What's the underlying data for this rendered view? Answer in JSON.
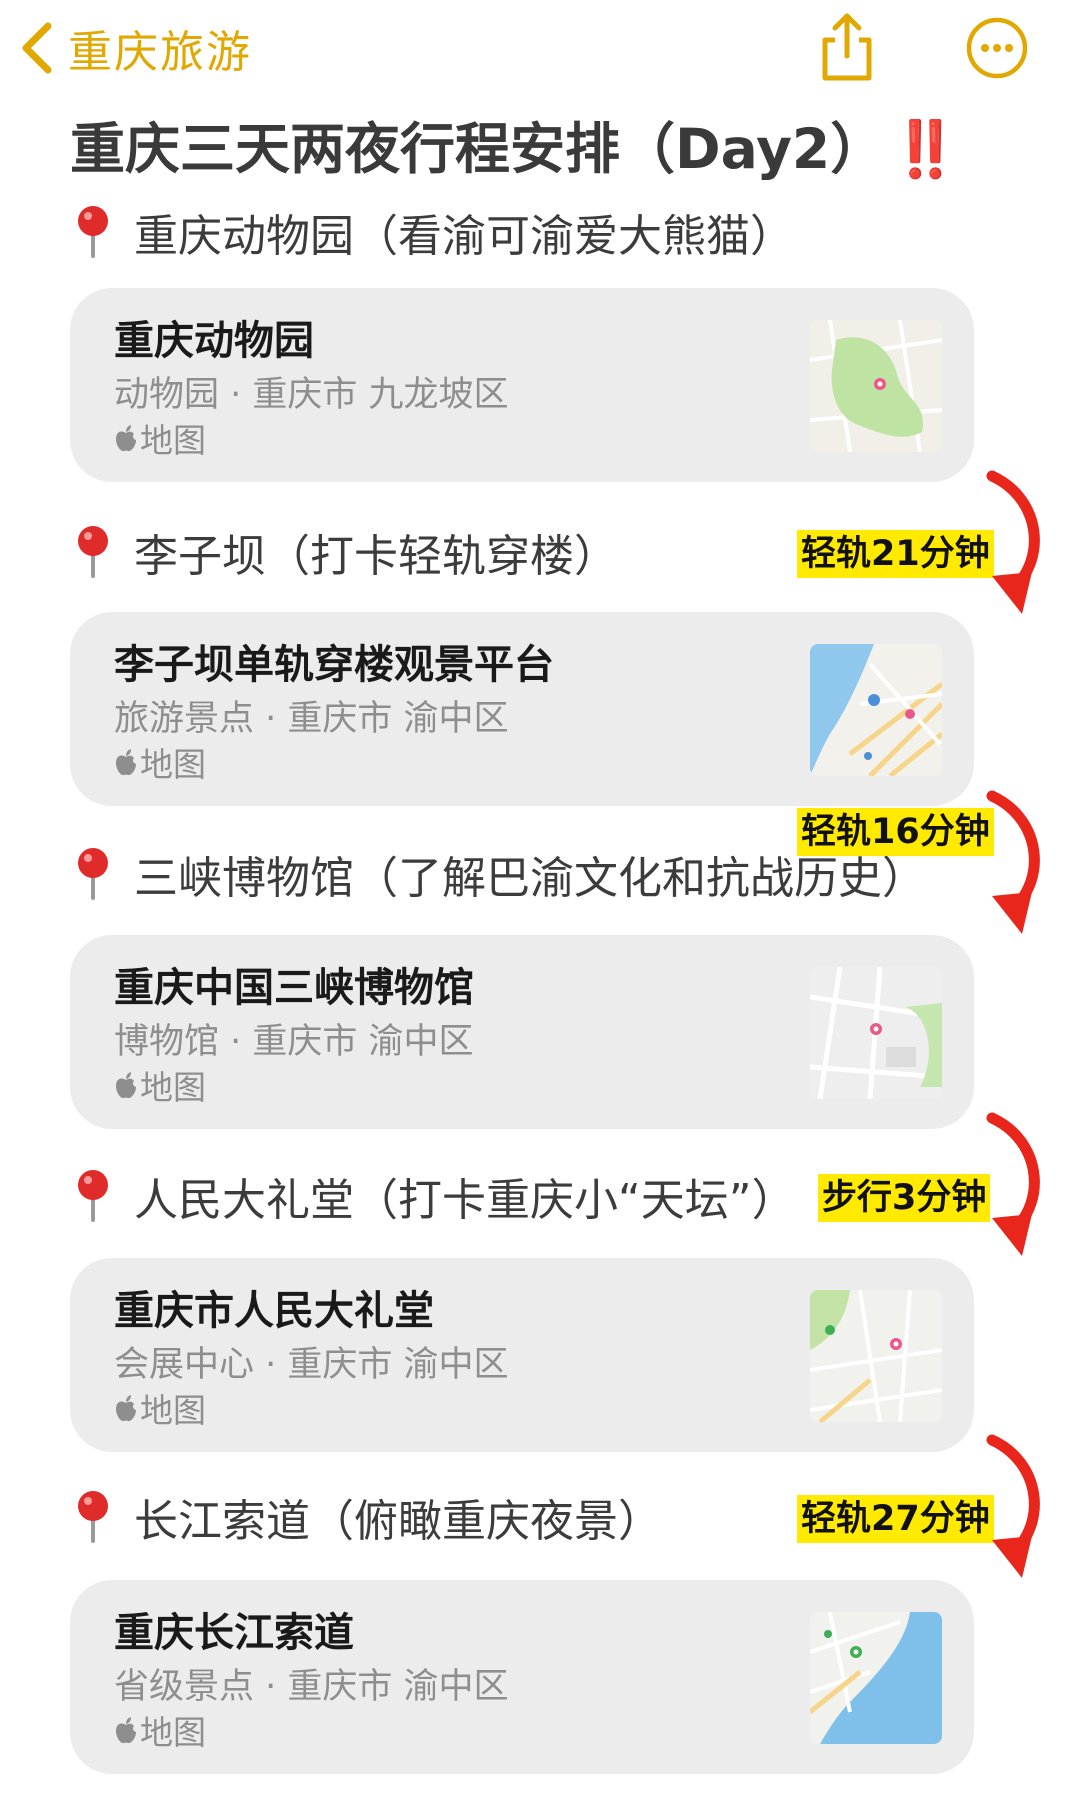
{
  "nav": {
    "back_label": "重庆旅游",
    "accent_color": "#E0A800",
    "share_icon": "share-icon",
    "more_icon": "more-icon"
  },
  "title": {
    "text": "重庆三天两夜行程安排（Day2）",
    "emphasis": "‼️"
  },
  "stops": [
    {
      "heading": "重庆动物园（看渝可渝爱大熊猫）",
      "card": {
        "name": "重庆动物园",
        "category": "动物园 · 重庆市 九龙坡区",
        "maps_label": "地图",
        "map": "green-park"
      }
    },
    {
      "heading": "李子坝（打卡轻轨穿楼）",
      "transit": "轻轨21分钟",
      "card": {
        "name": "李子坝单轨穿楼观景平台",
        "category": "旅游景点 · 重庆市 渝中区",
        "maps_label": "地图",
        "map": "river-city"
      }
    },
    {
      "heading": "三峡博物馆（了解巴渝文化和抗战历史）",
      "transit": "轻轨16分钟",
      "card": {
        "name": "重庆中国三峡博物馆",
        "category": "博物馆 · 重庆市 渝中区",
        "maps_label": "地图",
        "map": "city-grey"
      }
    },
    {
      "heading": "人民大礼堂（打卡重庆小“天坛”）",
      "transit": "步行3分钟",
      "card": {
        "name": "重庆市人民大礼堂",
        "category": "会展中心 · 重庆市 渝中区",
        "maps_label": "地图",
        "map": "city-green"
      }
    },
    {
      "heading": "长江索道（俯瞰重庆夜景）",
      "transit": "轻轨27分钟",
      "card": {
        "name": "重庆长江索道",
        "category": "省级景点 · 重庆市 渝中区",
        "maps_label": "地图",
        "map": "river-blue"
      }
    }
  ],
  "colors": {
    "card_bg": "#ececec",
    "transit_highlight": "#ffea00",
    "arrow": "#e8261c",
    "pin": "#e02b2b"
  }
}
